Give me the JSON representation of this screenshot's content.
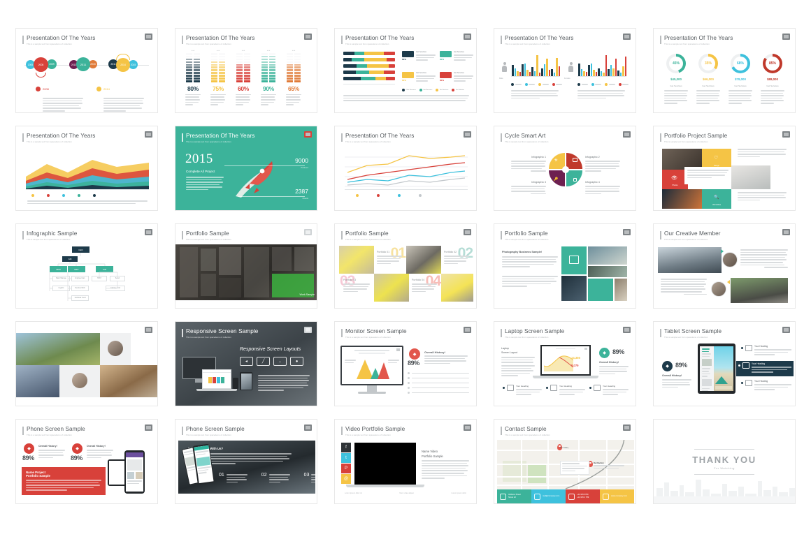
{
  "meta": {
    "background": "#ffffff",
    "grid": {
      "columns": 5,
      "rows": 5,
      "total_slides": 25
    },
    "palette": {
      "teal": "#3cb39a",
      "red": "#d8413a",
      "yellow": "#f5c445",
      "navy": "#1d3a4a",
      "purple": "#6d2050",
      "cyan": "#3ec1dd",
      "orange": "#e07b39",
      "gray_text": "#53585c",
      "sub_text": "#b6b9bc"
    }
  },
  "slides": [
    {
      "id": 1,
      "title": "Presentation Of The Years",
      "subtitle": "This is a sample text from spacedemo of collection",
      "type": "timeline-bubbles",
      "bubbles": [
        {
          "label": "2005",
          "color": "#3ec1dd",
          "size": 13
        },
        {
          "label": "2008",
          "color": "#d8413a",
          "size": 21
        },
        {
          "label": "2009",
          "color": "#3cb39a",
          "size": 14
        },
        {
          "label": "2013",
          "color": "#6d2050",
          "size": 13
        },
        {
          "label": "2011",
          "color": "#3cb39a",
          "size": 20
        },
        {
          "label": "2015",
          "color": "#e07b39",
          "size": 12
        },
        {
          "label": "2011",
          "color": "#1d3a4a",
          "size": 14
        },
        {
          "label": "2014",
          "color": "#f5c445",
          "size": 20
        },
        {
          "label": "2015",
          "color": "#3ec1dd",
          "size": 13
        }
      ],
      "notes": [
        {
          "year": "2008",
          "color": "#d8413a"
        },
        {
          "year": "2014",
          "color": "#f5c445"
        }
      ]
    },
    {
      "id": 2,
      "title": "Presentation Of The Years",
      "subtitle": "This is a sample text from spacedemo of collection",
      "type": "stacked-block-bars",
      "columns": [
        {
          "percent": "80%",
          "color": "#1d3a4a",
          "filled": 9
        },
        {
          "percent": "75%",
          "color": "#f5c445",
          "filled": 8
        },
        {
          "percent": "60%",
          "color": "#d8413a",
          "filled": 7
        },
        {
          "percent": "90%",
          "color": "#3cb39a",
          "filled": 10
        },
        {
          "percent": "65%",
          "color": "#e07b39",
          "filled": 7
        }
      ]
    },
    {
      "id": 3,
      "title": "Presentation Of The Years",
      "subtitle": "This is sample text from spacedemo of collection",
      "type": "horizontal-stacked-bars",
      "series_colors": [
        "#1d3a4a",
        "#3cb39a",
        "#f5c445",
        "#d8413a"
      ],
      "rows": [
        [
          22,
          18,
          38,
          22
        ],
        [
          16,
          24,
          44,
          16
        ],
        [
          26,
          20,
          42,
          12
        ],
        [
          24,
          26,
          28,
          22
        ],
        [
          26,
          22,
          16,
          14
        ]
      ],
      "cards": [
        {
          "percent": "80%",
          "color": "#1d3a4a",
          "label": "Get Services"
        },
        {
          "percent": "80%",
          "color": "#3cb39a",
          "label": "Get Services"
        },
        {
          "percent": "80%",
          "color": "#f5c445",
          "label": "Get Services"
        },
        {
          "percent": "80%",
          "color": "#d8413a",
          "label": "Get Services"
        }
      ],
      "legend": [
        "Offer Business",
        "Get Business",
        "Get Services",
        "Get Solution"
      ]
    },
    {
      "id": 4,
      "title": "Presentation Of The Years",
      "subtitle": "This is a sample text from spacedemo of collection",
      "type": "grouped-column-pair",
      "groups": [
        "Male",
        "Female"
      ],
      "series_colors": [
        "#1d3a4a",
        "#3ec1dd",
        "#f5c445",
        "#d8413a"
      ],
      "male_values": [
        [
          30,
          22,
          14,
          12
        ],
        [
          32,
          34,
          18,
          12
        ],
        [
          25,
          14,
          58,
          10
        ],
        [
          22,
          32,
          48,
          18
        ],
        [
          20,
          10,
          50,
          26
        ]
      ],
      "female_values": [
        [
          34,
          20,
          14,
          12
        ],
        [
          30,
          34,
          18,
          12
        ],
        [
          22,
          14,
          10,
          58
        ],
        [
          20,
          30,
          22,
          48
        ],
        [
          16,
          10,
          26,
          54
        ]
      ]
    },
    {
      "id": 5,
      "title": "Presentation Of The Years",
      "subtitle": "This is a sample text from spacedemo of collection",
      "type": "donut-kpi",
      "donuts": [
        {
          "percent": "45%",
          "value": 45,
          "amount": "$45,000",
          "label": "Get Services",
          "color": "#3cb39a"
        },
        {
          "percent": "35%",
          "value": 35,
          "amount": "$66,000",
          "label": "Get Services",
          "color": "#f5c445"
        },
        {
          "percent": "68%",
          "value": 68,
          "amount": "$78,000",
          "label": "Get Services",
          "color": "#3ec1dd"
        },
        {
          "percent": "85%",
          "value": 85,
          "amount": "$88,000",
          "label": "Get Services",
          "color": "#c0392b"
        }
      ]
    },
    {
      "id": 6,
      "title": "Presentation Of The Years",
      "subtitle": "This is a sample text from spacedemo of collection",
      "type": "area-chart",
      "series_colors": [
        "#f5c445",
        "#d8413a",
        "#3ec1dd",
        "#3cb39a",
        "#1d3a4a"
      ],
      "legend": [
        "Jan",
        "Feb",
        "Mar",
        "Apr"
      ]
    },
    {
      "id": 7,
      "title": "Presentation Of The Years",
      "subtitle": "This is a sample text from spacedemo of collection",
      "type": "rocket-hero",
      "background": "#3cb39a",
      "year": "2015",
      "caption": "Complete All Project",
      "stats": [
        {
          "value": "9000",
          "label": "Partners"
        },
        {
          "value": "2387",
          "label": "Clients"
        }
      ]
    },
    {
      "id": 8,
      "title": "Presentation Of The Years",
      "subtitle": "This is a sample text from spacedemo of collection",
      "type": "line-chart",
      "series_colors": [
        "#f5c445",
        "#d8413a",
        "#3ec1dd",
        "#bfc4c8"
      ],
      "legend": [
        "Jan",
        "Feb",
        "Mar",
        "Apr"
      ]
    },
    {
      "id": 9,
      "title": "Cycle Smart Art",
      "subtitle": "This is sample text from spacedemo of collection",
      "type": "pie-cycle",
      "quadrants": [
        {
          "label": "Infographic 1",
          "color": "#f5c445",
          "icon": "wrench-icon"
        },
        {
          "label": "Infographic 2",
          "color": "#c0392b",
          "icon": "briefcase-icon"
        },
        {
          "label": "Infographic 3",
          "color": "#6d2050",
          "icon": "key-icon"
        },
        {
          "label": "Infographic 4",
          "color": "#3cb39a",
          "icon": "lock-icon"
        }
      ]
    },
    {
      "id": 10,
      "title": "Portfolio Project Sample",
      "subtitle": "This is sample text from spacedemo of collection",
      "type": "portfolio-mosaic",
      "tiles": [
        {
          "label": "Photos",
          "color": "#d8413a",
          "icon": "eye-icon"
        },
        {
          "label": "Design",
          "color": "#f5c445",
          "icon": "heart-icon"
        },
        {
          "label": "Work Idea",
          "color": "#3cb39a",
          "icon": "search-icon"
        }
      ]
    },
    {
      "id": 11,
      "title": "Infographic Sample",
      "subtitle": "This is sample text from spacedemo of collection",
      "type": "org-tree",
      "root": "CEO",
      "level2": "GM",
      "level3": [
        "HRD",
        "MKT",
        "FIN"
      ],
      "leaves": [
        "Basic Manage",
        "Engineerman",
        "TEST",
        "Select",
        "Logistic",
        "Develop Work",
        "Call Fee Goal",
        "Technical Trend"
      ]
    },
    {
      "id": 12,
      "title": "Portfolio Sample",
      "subtitle": "This is a sample text from spacedemo of collection",
      "type": "photo-grid-dark"
    },
    {
      "id": 13,
      "title": "Portfolio Sample",
      "subtitle": "This is a sample text from spacedemo of collection",
      "type": "portfolio-numbers",
      "items": [
        {
          "number": "01",
          "label": "Portfolio 01",
          "color": "#f5c445"
        },
        {
          "number": "02",
          "label": "Portfolio 02",
          "color": "#9fd9d0"
        },
        {
          "number": "03",
          "label": "Portfolio 03",
          "color": "#f2a8bd"
        },
        {
          "number": "04",
          "label": "Portfolio 04",
          "color": "#f09a9a"
        }
      ]
    },
    {
      "id": 14,
      "title": "Portfolio Sample",
      "subtitle": "This is sample text from spacedemo of collection",
      "type": "photo-feature",
      "heading": "Photography Business Sample!"
    },
    {
      "id": 15,
      "title": "Our Creative Member",
      "subtitle": "This is sample text from spacedemo of collection",
      "type": "team-members"
    },
    {
      "id": 16,
      "title": "",
      "subtitle": "",
      "type": "photo-collage-left"
    },
    {
      "id": 17,
      "title": "Responsive Screen Sample",
      "subtitle": "This is a sample text from spacedemo of collection",
      "type": "responsive-devices",
      "heading": "Responsive Screen Layouts",
      "icons": [
        "rocket-icon",
        "pencil-icon",
        "resize-icon",
        "chat-icon"
      ]
    },
    {
      "id": 18,
      "title": "Monitor Screen Sample",
      "subtitle": "This is a sample text from spacedemo of collection",
      "type": "monitor-mockup",
      "percent": "89%",
      "kpi_label": "Overall History!",
      "icon": "diamond-icon",
      "icon_color": "#e2574c"
    },
    {
      "id": 19,
      "title": "Laptop Screen Sample",
      "subtitle": "This is sample text from spacedemo of collection",
      "type": "laptop-mockup",
      "side_title": "Laptop",
      "side_title2": "Screen Layout",
      "percent": "89%",
      "kpi_label": "Overall History!",
      "icon_color": "#3cb39a",
      "chart_labels": [
        "14,356",
        "8,079"
      ],
      "features": [
        {
          "heading": "Your Heading",
          "icon": "camera-icon"
        },
        {
          "heading": "Your Heading",
          "icon": "news-icon"
        },
        {
          "heading": "Your Heading",
          "icon": "print-icon"
        }
      ]
    },
    {
      "id": 20,
      "title": "Tablet Screen Sample",
      "subtitle": "This is sample text from spacedemo of collection",
      "type": "tablet-mockup",
      "percent": "89%",
      "kpi_label": "Overall History!",
      "icon_color": "#1d3a4a",
      "features": [
        {
          "heading": "Your Heading",
          "icon": "camera-icon",
          "active": false
        },
        {
          "heading": "Your Heading",
          "icon": "news-icon",
          "active": true
        },
        {
          "heading": "Your Heading",
          "icon": "print-icon",
          "active": false
        }
      ]
    },
    {
      "id": 21,
      "title": "Phone Screen Sample",
      "subtitle": "This is a sample text from spacedemo of collection",
      "type": "phone-mockup-light",
      "kpis": [
        {
          "percent": "89%",
          "label": "Overall History!",
          "color": "#d8413a"
        },
        {
          "percent": "89%",
          "label": "Overall History!",
          "color": "#d8413a"
        }
      ],
      "banner_line1": "Name Project",
      "banner_line2": "Portfolio Sample",
      "banner_color": "#d8413a"
    },
    {
      "id": 22,
      "title": "Phone Screen Sample",
      "subtitle": "This is a sample text from spacedemo of collection",
      "type": "phone-mockup-dark",
      "heading": "Why Business With Us?",
      "steps": [
        "01",
        "02",
        "03"
      ]
    },
    {
      "id": 23,
      "title": "Video Portfolio Sample",
      "subtitle": "This is a sample text from spacedemo of collection",
      "type": "video-laptop",
      "side_line1": "Name Video",
      "side_line2": "Portfolio Sample",
      "social": [
        {
          "name": "facebook-icon",
          "glyph": "f",
          "color": "#2f3337"
        },
        {
          "name": "twitter-icon",
          "glyph": "t",
          "color": "#3ec1dd"
        },
        {
          "name": "pinterest-icon",
          "glyph": "P",
          "color": "#d8413a"
        },
        {
          "name": "mail-icon",
          "glyph": "@",
          "color": "#f5c445"
        }
      ],
      "footer": [
        "Lorem ipsum dolor sit",
        "Nunc vitae aliquet",
        "Lorem ipsum dolor"
      ]
    },
    {
      "id": 24,
      "title": "Contact Sample",
      "subtitle": "This is a sample text from spacedemo of collection",
      "type": "contact-map",
      "contacts": [
        {
          "icon": "pin-icon",
          "color": "#3cb39a",
          "line1": "Address Street",
          "line2": "Street 22"
        },
        {
          "icon": "mail-icon",
          "color": "#3ec1dd",
          "line1": "mail@company.com",
          "line2": ""
        },
        {
          "icon": "phone-icon",
          "color": "#d8413a",
          "line1": "+12 345 6789",
          "line2": "+12 345 4 789"
        },
        {
          "icon": "monitor-icon",
          "color": "#f5c445",
          "line1": "www.company.com",
          "line2": ""
        }
      ]
    },
    {
      "id": 25,
      "title": "",
      "subtitle": "",
      "type": "thank-you",
      "headline": "THANK YOU",
      "sub": "For Watching"
    }
  ]
}
